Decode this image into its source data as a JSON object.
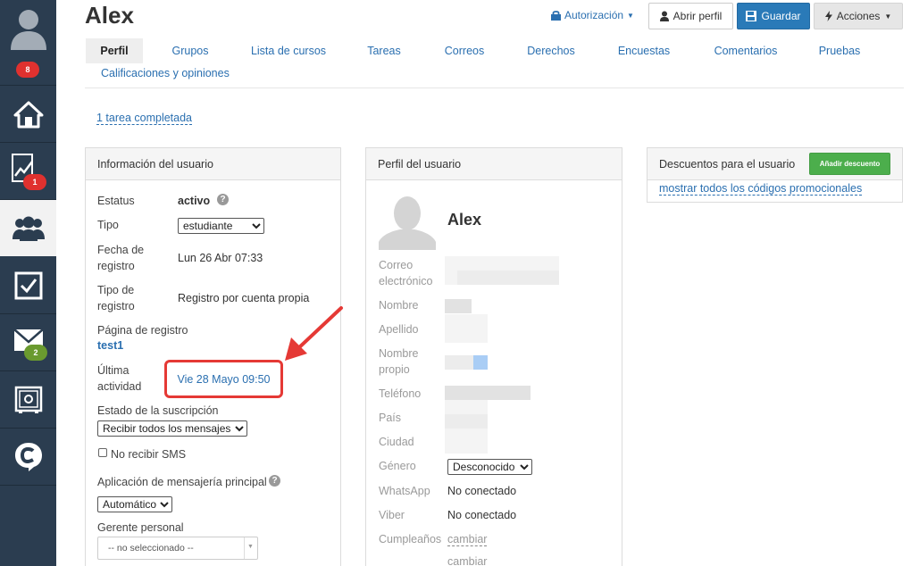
{
  "sidebar": {
    "badges": {
      "profile": "8",
      "reports": "1",
      "messages": "2"
    },
    "icons": [
      "user-avatar-icon",
      "home-icon",
      "chart-icon",
      "users-icon",
      "checkbox-icon",
      "mail-icon",
      "safe-icon",
      "chat-logo-icon"
    ]
  },
  "header": {
    "user_name": "Alex",
    "authorization": "Autorización",
    "open_profile": "Abrir perfil",
    "save": "Guardar",
    "actions": "Acciones"
  },
  "tabs": [
    "Perfil",
    "Grupos",
    "Lista de cursos",
    "Tareas",
    "Correos",
    "Derechos",
    "Encuestas",
    "Comentarios",
    "Pruebas",
    "Calificaciones y opiniones"
  ],
  "tasks_link": "1 tarea completada",
  "user_info": {
    "title": "Información del usuario",
    "status_label": "Estatus",
    "status_value": "activo",
    "type_label": "Tipo",
    "type_value": "estudiante",
    "reg_date_label_1": "Fecha de",
    "reg_date_label_2": "registro",
    "reg_date_value": "Lun 26 Abr 07:33",
    "reg_type_label_1": "Tipo de",
    "reg_type_label_2": "registro",
    "reg_type_value": "Registro por cuenta propia",
    "reg_page_label": "Página de registro",
    "reg_page_value": "test1",
    "last_activity_label_1": "Última",
    "last_activity_label_2": "actividad",
    "last_activity_value": "Vie 28 Mayo 09:50",
    "subscription_label": "Estado de la suscripción",
    "subscription_value": "Recibir todos los mensajes",
    "no_sms_label": "No recibir SMS",
    "messenger_label": "Aplicación de mensajería principal",
    "messenger_value": "Automático",
    "manager_label": "Gerente personal",
    "manager_value": "-- no seleccionado --"
  },
  "user_profile": {
    "title": "Perfil del usuario",
    "name": "Alex",
    "email_label_1": "Correo",
    "email_label_2": "electrónico",
    "first_name_label": "Nombre",
    "last_name_label": "Apellido",
    "own_name_label_1": "Nombre",
    "own_name_label_2": "propio",
    "phone_label": "Teléfono",
    "country_label": "País",
    "city_label": "Ciudad",
    "gender_label": "Género",
    "gender_value": "Desconocido",
    "whatsapp_label": "WhatsApp",
    "whatsapp_value": "No conectado",
    "viber_label": "Viber",
    "viber_value": "No conectado",
    "birthday_label": "Cumpleaños",
    "change_1": "cambiar",
    "change_2": "cambiar"
  },
  "discounts": {
    "title": "Descuentos para el usuario",
    "add_button": "Añadir descuento",
    "show_codes": "mostrar todos los códigos promocionales"
  },
  "colors": {
    "sidebar": "#2b3d50",
    "link": "#2a6fb0",
    "primary_button": "#2a7ab8",
    "success_button": "#4cae4c",
    "highlight": "#e53935"
  }
}
